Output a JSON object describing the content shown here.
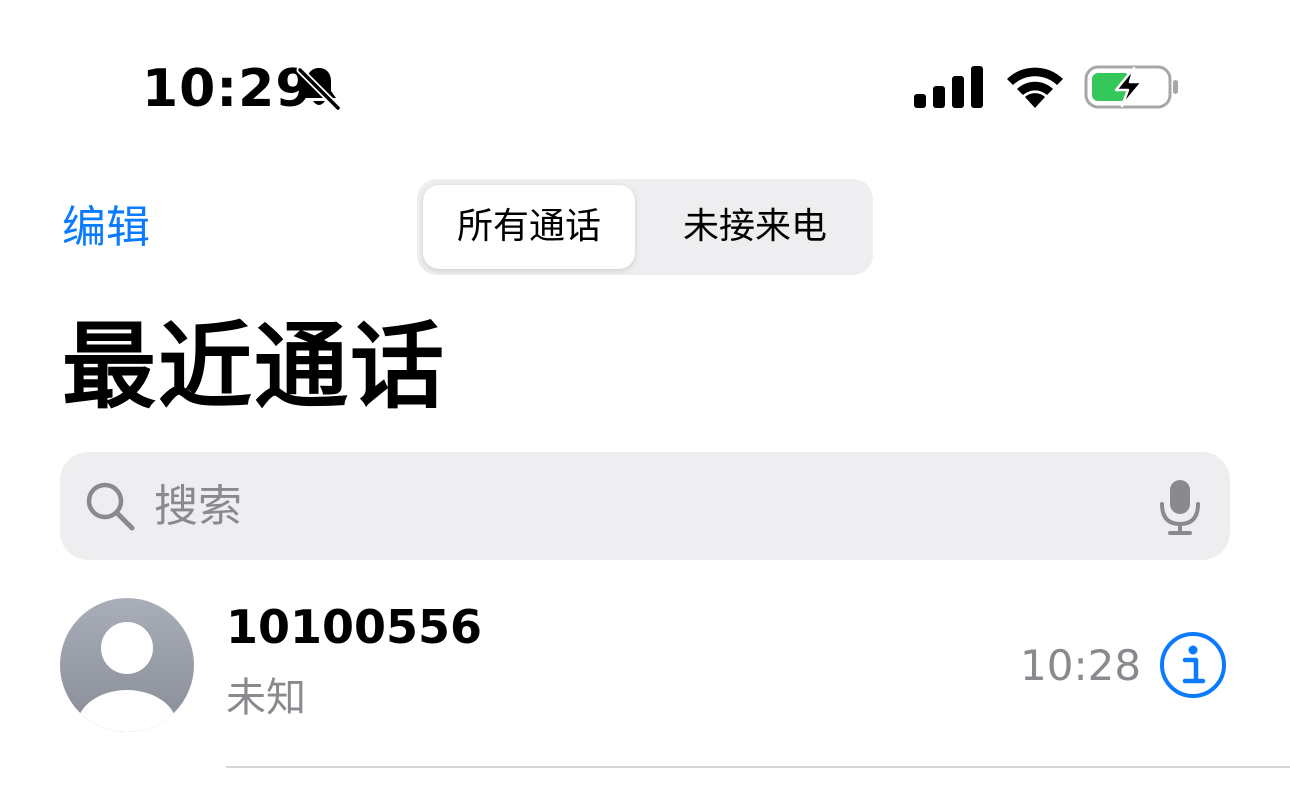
{
  "status_bar": {
    "time": "10:29",
    "icons": [
      "bell-slash-icon",
      "cellular-signal-icon",
      "wifi-icon",
      "battery-charging-icon"
    ],
    "battery_color": "#34c759"
  },
  "nav": {
    "edit_label": "编辑",
    "segments": [
      {
        "label": "所有通话",
        "selected": true
      },
      {
        "label": "未接来电",
        "selected": false
      }
    ]
  },
  "title": "最近通话",
  "search": {
    "placeholder": "搜索"
  },
  "calls": [
    {
      "name": "10100556",
      "type": "未知",
      "time": "10:28"
    }
  ],
  "colors": {
    "accent": "#0a7aff",
    "secondary_text": "#8a8a8e",
    "fill": "#eeeef0"
  }
}
